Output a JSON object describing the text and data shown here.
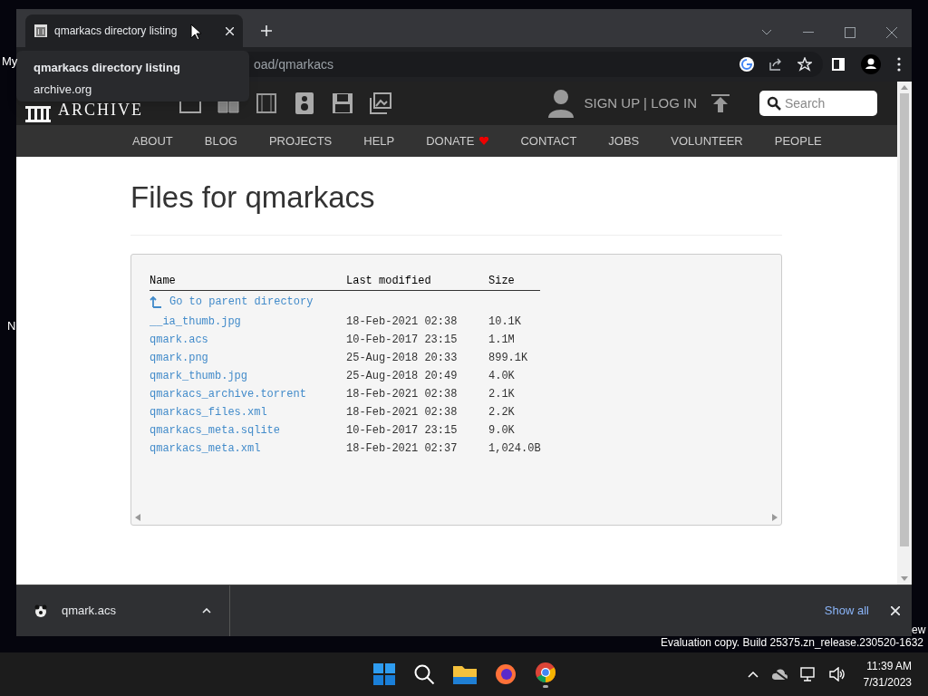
{
  "desktop_fragments": [
    "My",
    "N",
    "ew"
  ],
  "browser": {
    "tabs": [
      {
        "title": "qmarkacs directory listing",
        "selected": true
      }
    ],
    "tooltip": {
      "title": "qmarkacs directory listing",
      "host": "archive.org"
    },
    "address": "oad/qmarkacs"
  },
  "site_header": {
    "logo": "ARCHIVE",
    "account": "SIGN UP | LOG IN",
    "search": {
      "placeholder": "Search"
    }
  },
  "nav": [
    {
      "label": "ABOUT"
    },
    {
      "label": "BLOG"
    },
    {
      "label": "PROJECTS"
    },
    {
      "label": "HELP"
    },
    {
      "label": "DONATE",
      "heart": true
    },
    {
      "label": "CONTACT"
    },
    {
      "label": "JOBS"
    },
    {
      "label": "VOLUNTEER"
    },
    {
      "label": "PEOPLE"
    }
  ],
  "page": {
    "heading": "Files for qmarkacs",
    "columns": [
      "Name",
      "Last modified",
      "Size"
    ],
    "parent_link": "Go to parent directory",
    "rows": [
      {
        "name": "__ia_thumb.jpg",
        "modified": "18-Feb-2021 02:38",
        "size": "10.1K"
      },
      {
        "name": "qmark.acs",
        "modified": "10-Feb-2017 23:15",
        "size": "1.1M"
      },
      {
        "name": "qmark.png",
        "modified": "25-Aug-2018 20:33",
        "size": "899.1K"
      },
      {
        "name": "qmark_thumb.jpg",
        "modified": "25-Aug-2018 20:49",
        "size": "4.0K"
      },
      {
        "name": "qmarkacs_archive.torrent",
        "modified": "18-Feb-2021 02:38",
        "size": "2.1K"
      },
      {
        "name": "qmarkacs_files.xml",
        "modified": "18-Feb-2021 02:38",
        "size": "2.2K"
      },
      {
        "name": "qmarkacs_meta.sqlite",
        "modified": "10-Feb-2017 23:15",
        "size": "9.0K"
      },
      {
        "name": "qmarkacs_meta.xml",
        "modified": "18-Feb-2021 02:37",
        "size": "1,024.0B"
      }
    ]
  },
  "download_bar": {
    "file": "qmark.acs",
    "show_all": "Show all"
  },
  "os_notice": "Evaluation copy. Build 25375.zn_release.230520-1632",
  "taskbar": {
    "time": "11:39 AM",
    "date": "7/31/2023"
  }
}
